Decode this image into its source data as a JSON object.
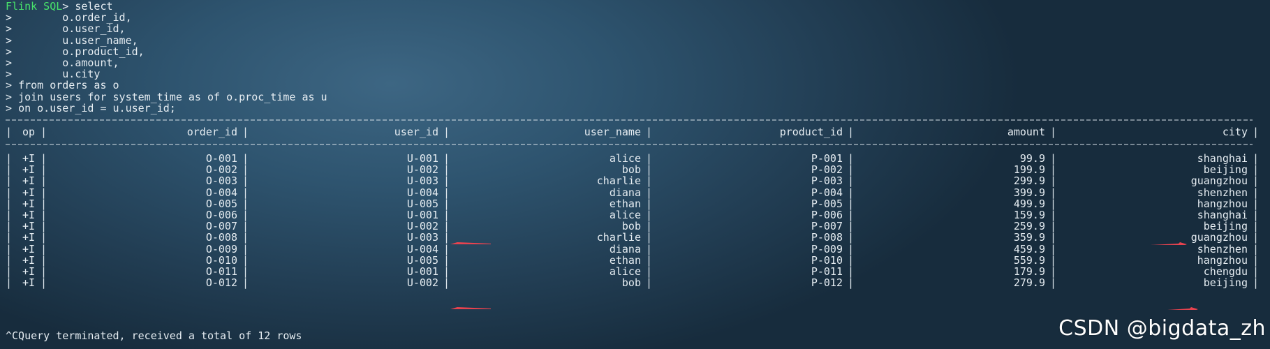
{
  "terminal": {
    "prompt": "Flink SQL",
    "prompt_suffix": "> ",
    "continuation": ">",
    "sql_lines": [
      "select",
      "    o.order_id,",
      "    o.user_id,",
      "    u.user_name,",
      "    o.product_id,",
      "    o.amount,",
      "    u.city",
      "from orders as o",
      "join users for system_time as of o.proc_time as u",
      "on o.user_id = u.user_id;"
    ]
  },
  "result_table": {
    "columns": [
      "op",
      "order_id",
      "user_id",
      "user_name",
      "product_id",
      "amount",
      "city"
    ],
    "rows": [
      [
        "+I",
        "O-001",
        "U-001",
        "alice",
        "P-001",
        "99.9",
        "shanghai"
      ],
      [
        "+I",
        "O-002",
        "U-002",
        "bob",
        "P-002",
        "199.9",
        "beijing"
      ],
      [
        "+I",
        "O-003",
        "U-003",
        "charlie",
        "P-003",
        "299.9",
        "guangzhou"
      ],
      [
        "+I",
        "O-004",
        "U-004",
        "diana",
        "P-004",
        "399.9",
        "shenzhen"
      ],
      [
        "+I",
        "O-005",
        "U-005",
        "ethan",
        "P-005",
        "499.9",
        "hangzhou"
      ],
      [
        "+I",
        "O-006",
        "U-001",
        "alice",
        "P-006",
        "159.9",
        "shanghai"
      ],
      [
        "+I",
        "O-007",
        "U-002",
        "bob",
        "P-007",
        "259.9",
        "beijing"
      ],
      [
        "+I",
        "O-008",
        "U-003",
        "charlie",
        "P-008",
        "359.9",
        "guangzhou"
      ],
      [
        "+I",
        "O-009",
        "U-004",
        "diana",
        "P-009",
        "459.9",
        "shenzhen"
      ],
      [
        "+I",
        "O-010",
        "U-005",
        "ethan",
        "P-010",
        "559.9",
        "hangzhou"
      ],
      [
        "+I",
        "O-011",
        "U-001",
        "alice",
        "P-011",
        "179.9",
        "chengdu"
      ],
      [
        "+I",
        "O-012",
        "U-002",
        "bob",
        "P-012",
        "279.9",
        "beijing"
      ]
    ]
  },
  "status_line": "^CQuery terminated, received a total of 12 rows",
  "watermark": "CSDN @bigdata_zh",
  "colors": {
    "prompt_green": "#48e36b",
    "annotation_arrow": "#e8434f",
    "text": "#e6edf2"
  }
}
